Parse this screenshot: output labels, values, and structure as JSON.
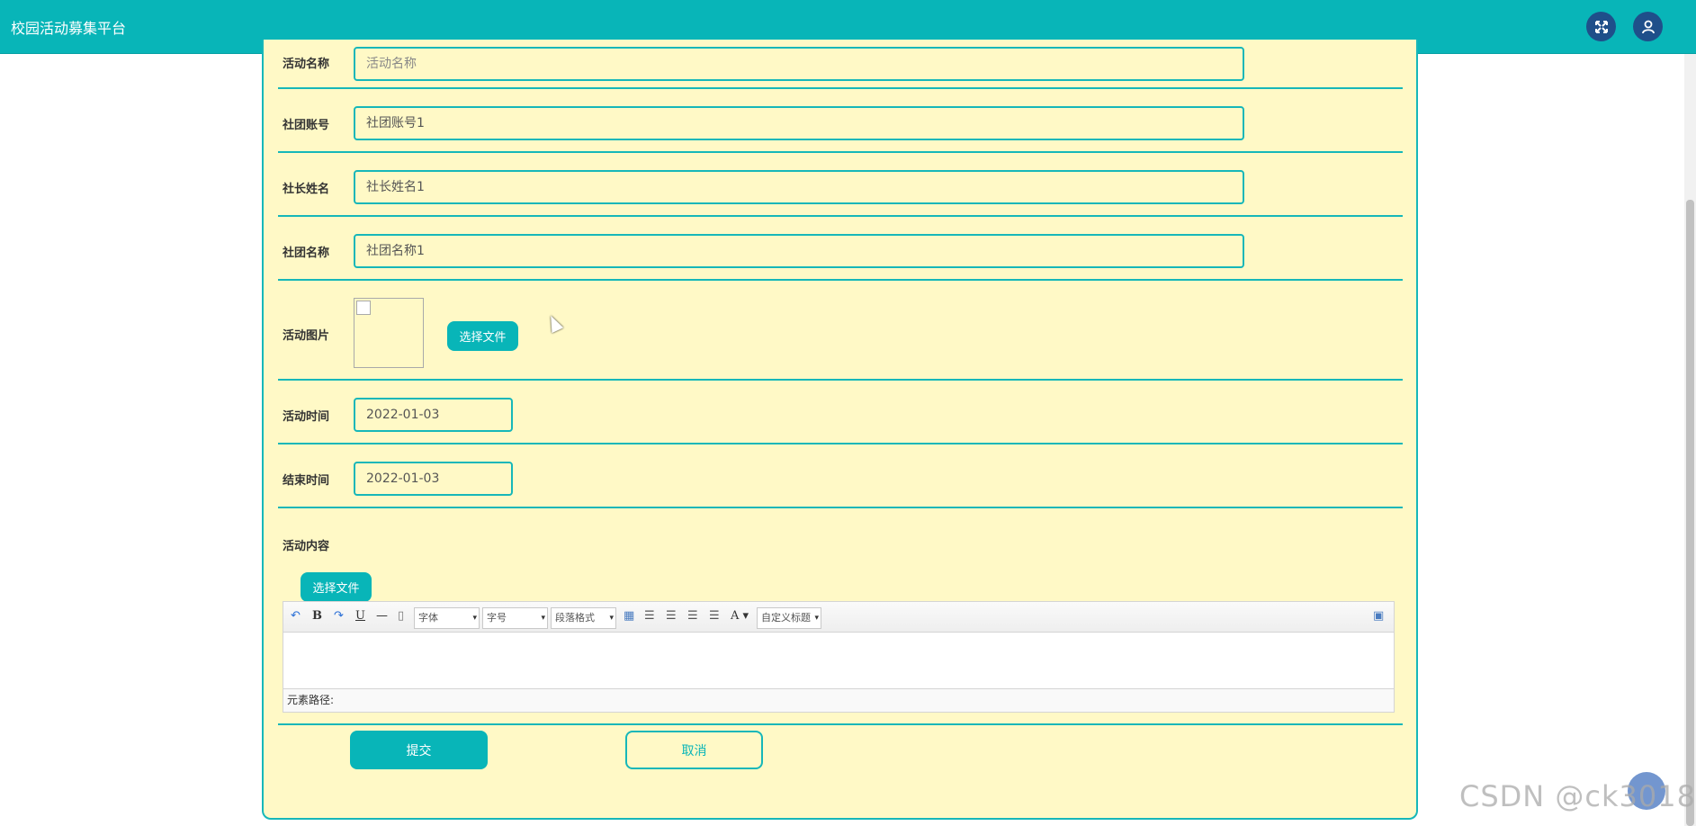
{
  "header": {
    "title": "校园活动募集平台"
  },
  "form": {
    "fields": [
      {
        "label": "活动名称",
        "value": "",
        "placeholder": "活动名称"
      },
      {
        "label": "社团账号",
        "value": "社团账号1"
      },
      {
        "label": "社长姓名",
        "value": "社长姓名1"
      },
      {
        "label": "社团名称",
        "value": "社团名称1"
      }
    ],
    "image_label": "活动图片",
    "image_button": "选择文件",
    "start_label": "活动时间",
    "start_value": "2022-01-03",
    "end_label": "结束时间",
    "end_value": "2022-01-03",
    "content_label": "活动内容",
    "content_button": "选择文件",
    "submit": "提交",
    "cancel": "取消"
  },
  "editor": {
    "font_family": "字体",
    "font_size": "字号",
    "paragraph": "段落格式",
    "custom_title": "自定义标题",
    "status": "元素路径:"
  },
  "watermark": "CSDN @ck3018",
  "colors": {
    "accent": "#08b5b8",
    "panel": "#fff9c6",
    "icon_bg": "#1f4f8a"
  }
}
